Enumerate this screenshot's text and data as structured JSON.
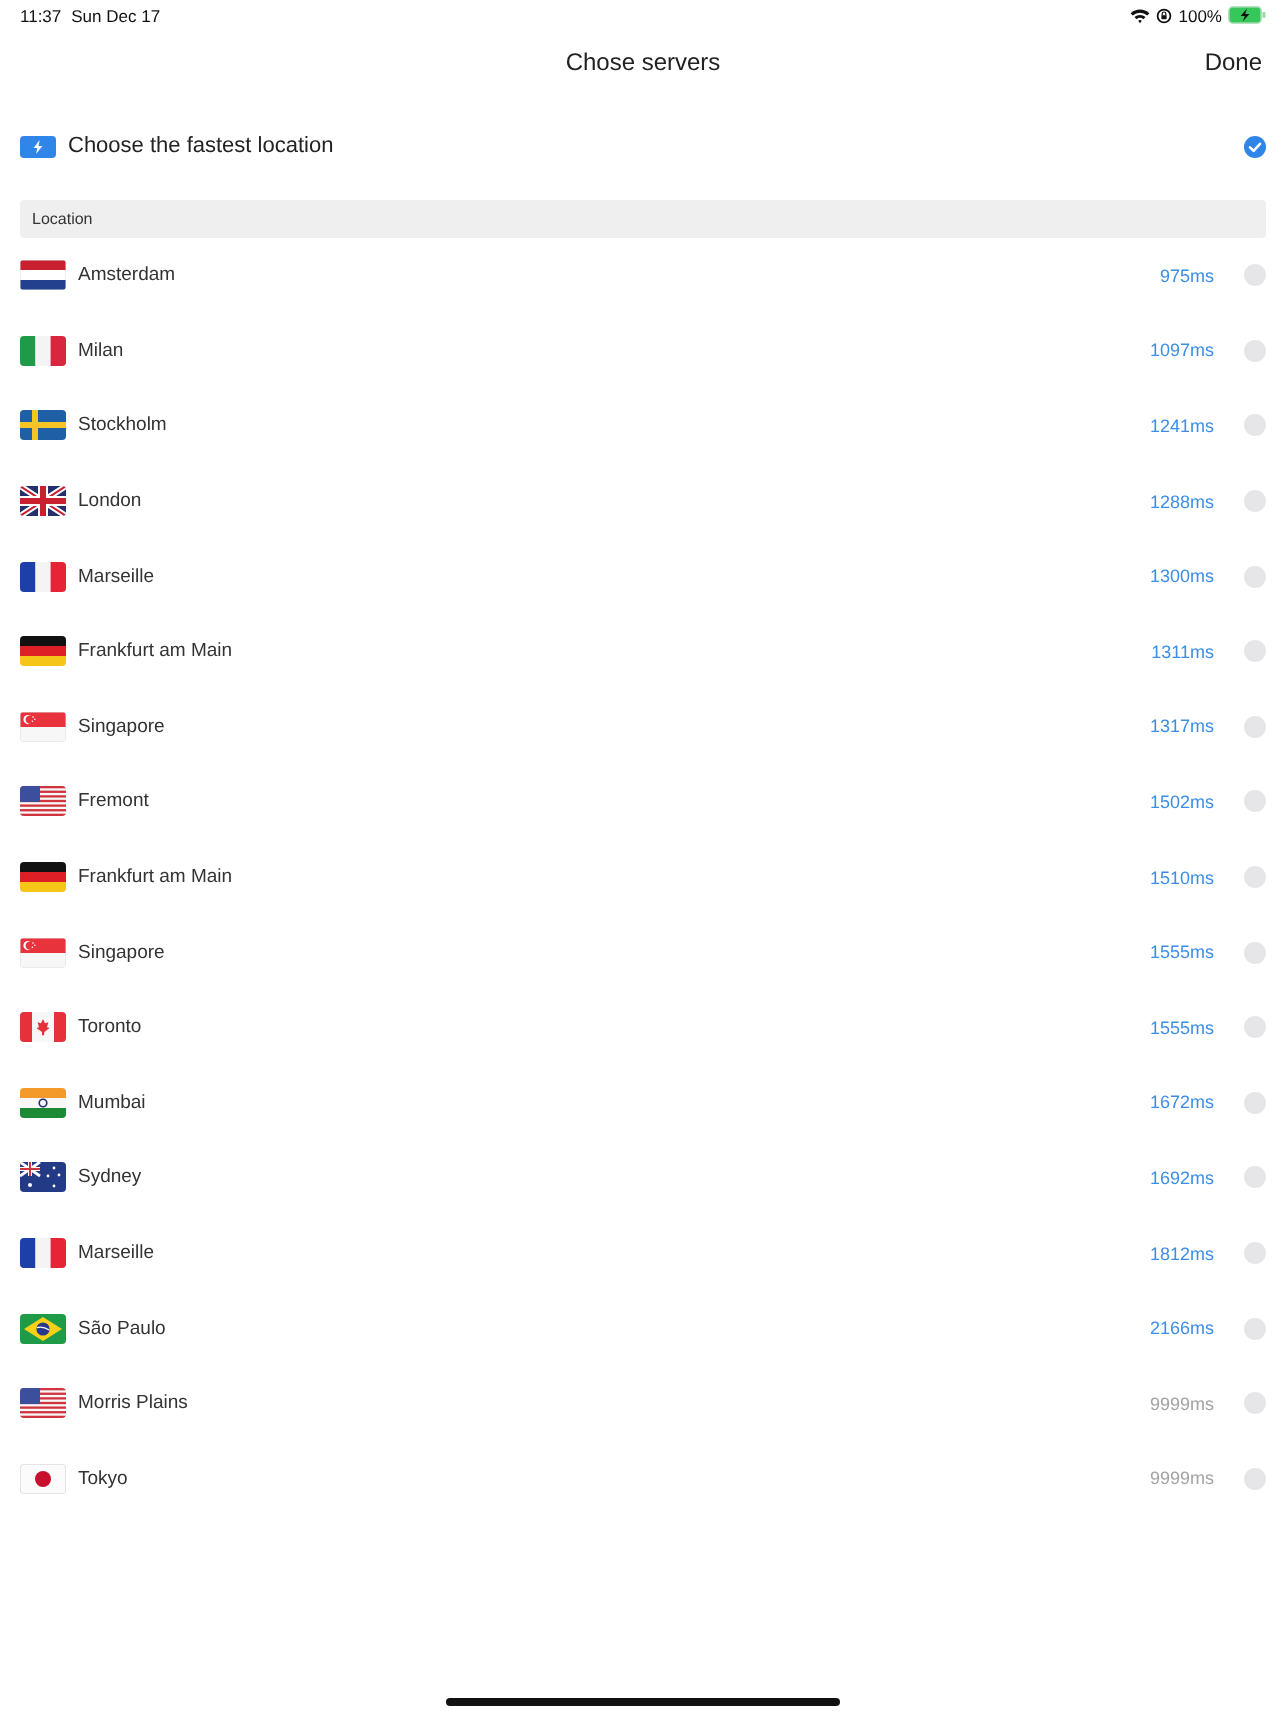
{
  "status_bar": {
    "time": "11:37",
    "date": "Sun Dec 17",
    "battery": "100%"
  },
  "nav": {
    "title": "Chose servers",
    "done": "Done"
  },
  "fastest": {
    "label": "Choose the fastest location",
    "checked": true
  },
  "section": {
    "title": "Location"
  },
  "servers": [
    {
      "kind": "netherlands",
      "name": "Amsterdam",
      "latency": "975ms",
      "color": "#3b8ee8",
      "selected": false
    },
    {
      "kind": "italy",
      "name": "Milan",
      "latency": "1097ms",
      "color": "#3b8ee8",
      "selected": false
    },
    {
      "kind": "sweden",
      "name": "Stockholm",
      "latency": "1241ms",
      "color": "#3b8ee8",
      "selected": false
    },
    {
      "kind": "uk",
      "name": "London",
      "latency": "1288ms",
      "color": "#3b8ee8",
      "selected": false
    },
    {
      "kind": "france",
      "name": "Marseille",
      "latency": "1300ms",
      "color": "#3b8ee8",
      "selected": false
    },
    {
      "kind": "germany",
      "name": "Frankfurt am Main",
      "latency": "1311ms",
      "color": "#3b8ee8",
      "selected": false
    },
    {
      "kind": "singapore",
      "name": "Singapore",
      "latency": "1317ms",
      "color": "#3b8ee8",
      "selected": false
    },
    {
      "kind": "usa",
      "name": "Fremont",
      "latency": "1502ms",
      "color": "#3b8ee8",
      "selected": false
    },
    {
      "kind": "germany",
      "name": "Frankfurt am Main",
      "latency": "1510ms",
      "color": "#3b8ee8",
      "selected": false
    },
    {
      "kind": "singapore",
      "name": "Singapore",
      "latency": "1555ms",
      "color": "#3b8ee8",
      "selected": false
    },
    {
      "kind": "canada",
      "name": "Toronto",
      "latency": "1555ms",
      "color": "#3b8ee8",
      "selected": false
    },
    {
      "kind": "india",
      "name": "Mumbai",
      "latency": "1672ms",
      "color": "#3b8ee8",
      "selected": false
    },
    {
      "kind": "australia",
      "name": "Sydney",
      "latency": "1692ms",
      "color": "#3b8ee8",
      "selected": false
    },
    {
      "kind": "france",
      "name": "Marseille",
      "latency": "1812ms",
      "color": "#3b8ee8",
      "selected": false
    },
    {
      "kind": "brazil",
      "name": "São Paulo",
      "latency": "2166ms",
      "color": "#3b8ee8",
      "selected": false
    },
    {
      "kind": "usa",
      "name": "Morris Plains",
      "latency": "9999ms",
      "color": "#a3a3a3",
      "selected": false
    },
    {
      "kind": "japan",
      "name": "Tokyo",
      "latency": "9999ms",
      "color": "#a3a3a3",
      "selected": false
    }
  ]
}
